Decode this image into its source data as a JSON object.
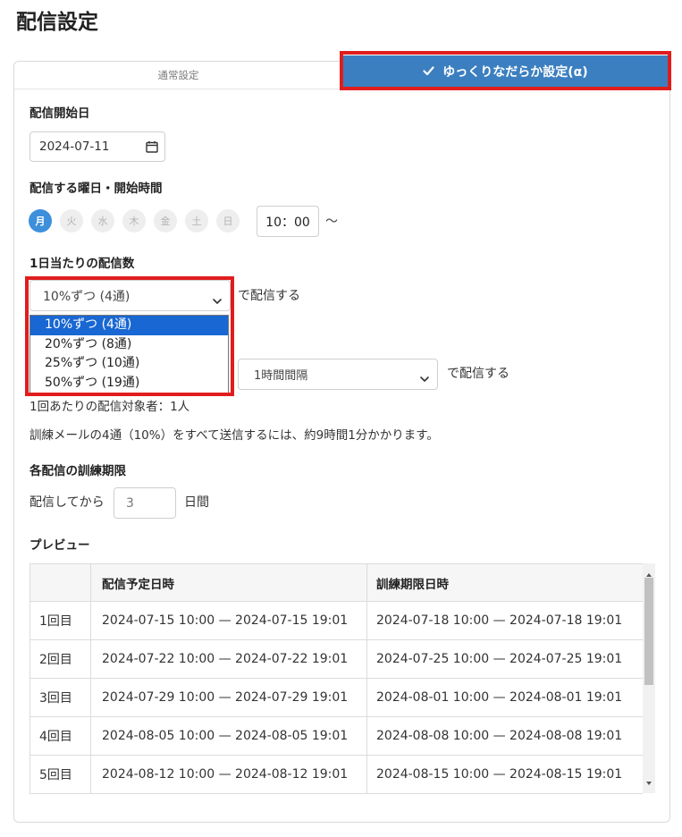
{
  "page": {
    "title": "配信設定"
  },
  "tabs": {
    "normal": {
      "label": "通常設定",
      "active": false
    },
    "gradual": {
      "label": "ゆっくりなだらか設定(α)",
      "active": true,
      "icon": "check-icon"
    }
  },
  "start_date": {
    "label": "配信開始日",
    "value": "2024-07-11",
    "icon": "calendar-icon"
  },
  "schedule": {
    "label": "配信する曜日・開始時間",
    "days": [
      {
        "label": "月",
        "selected": true
      },
      {
        "label": "火",
        "selected": false
      },
      {
        "label": "水",
        "selected": false
      },
      {
        "label": "木",
        "selected": false
      },
      {
        "label": "金",
        "selected": false
      },
      {
        "label": "土",
        "selected": false
      },
      {
        "label": "日",
        "selected": false
      }
    ],
    "start_time": "10：00",
    "range_separator": "～"
  },
  "daily_count": {
    "label": "1日当たりの配信数",
    "selected": "10%ずつ (4通)",
    "suffix": "で配信する",
    "icon": "chevron-down-icon",
    "options": [
      "10%ずつ (4通)",
      "20%ずつ (8通)",
      "25%ずつ (10通)",
      "50%ずつ (19通)"
    ],
    "highlighted_option_index": 0
  },
  "interval": {
    "selected": "1時間間隔",
    "suffix": "で配信する",
    "icon": "chevron-down-icon"
  },
  "summary": {
    "targets_per_send": "1回あたりの配信対象者：1人",
    "duration_note": "訓練メールの4通（10%）をすべて送信するには、約9時間1分かかります。"
  },
  "deadline": {
    "label": "各配信の訓練期限",
    "prefix": "配信してから",
    "days_value": "3",
    "suffix": "日間"
  },
  "preview": {
    "label": "プレビュー",
    "columns": {
      "send": "配信予定日時",
      "deadline": "訓練期限日時"
    },
    "rows": [
      {
        "round": "1回目",
        "send": "2024-07-15 10:00 — 2024-07-15 19:01",
        "deadline": "2024-07-18 10:00 — 2024-07-18 19:01"
      },
      {
        "round": "2回目",
        "send": "2024-07-22 10:00 — 2024-07-22 19:01",
        "deadline": "2024-07-25 10:00 — 2024-07-25 19:01"
      },
      {
        "round": "3回目",
        "send": "2024-07-29 10:00 — 2024-07-29 19:01",
        "deadline": "2024-08-01 10:00 — 2024-08-01 19:01"
      },
      {
        "round": "4回目",
        "send": "2024-08-05 10:00 — 2024-08-05 19:01",
        "deadline": "2024-08-08 10:00 — 2024-08-08 19:01"
      },
      {
        "round": "5回目",
        "send": "2024-08-12 10:00 — 2024-08-12 19:01",
        "deadline": "2024-08-15 10:00 — 2024-08-15 19:01"
      }
    ]
  },
  "colors": {
    "tab_active": "#3c7fc0",
    "day_selected": "#3d8fdb",
    "option_highlight": "#1967d2",
    "annotation_highlight": "#e01d1d"
  }
}
